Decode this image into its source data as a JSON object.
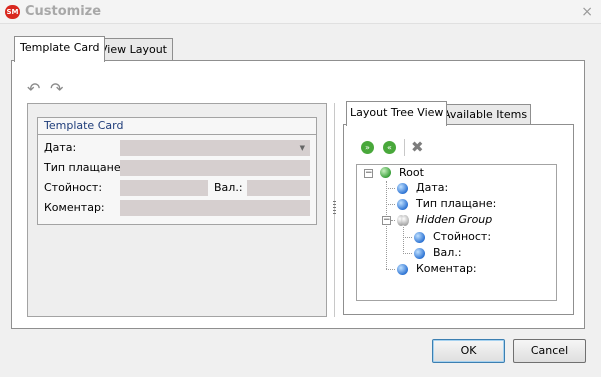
{
  "window": {
    "title": "Customize",
    "app_icon_text": "SM",
    "close_glyph": "×"
  },
  "outer_tabs": [
    "Template Card",
    "View Layout"
  ],
  "toolbar": {
    "undo_icon": "undo-arrow",
    "redo_icon": "redo-arrow"
  },
  "card": {
    "title": "Template Card",
    "fields": {
      "date_label": "Дата:",
      "payment_type_label": "Тип плащане:",
      "value_label": "Стойност:",
      "currency_label": "Вал.:",
      "comment_label": "Коментар:"
    }
  },
  "right_tabs": [
    "Layout Tree View",
    "Available Items"
  ],
  "tree": {
    "root": "Root",
    "items": {
      "date": "Дата:",
      "payment_type": "Тип плащане:",
      "hidden_group": "Hidden Group",
      "value": "Стойност:",
      "currency": "Вал.:",
      "comment": "Коментар:"
    }
  },
  "buttons": {
    "ok": "OK",
    "cancel": "Cancel"
  },
  "colors": {
    "field_bg": "#d6cfcf",
    "group_title": "#1f3d7a",
    "node_ball": "#2f75d4"
  }
}
